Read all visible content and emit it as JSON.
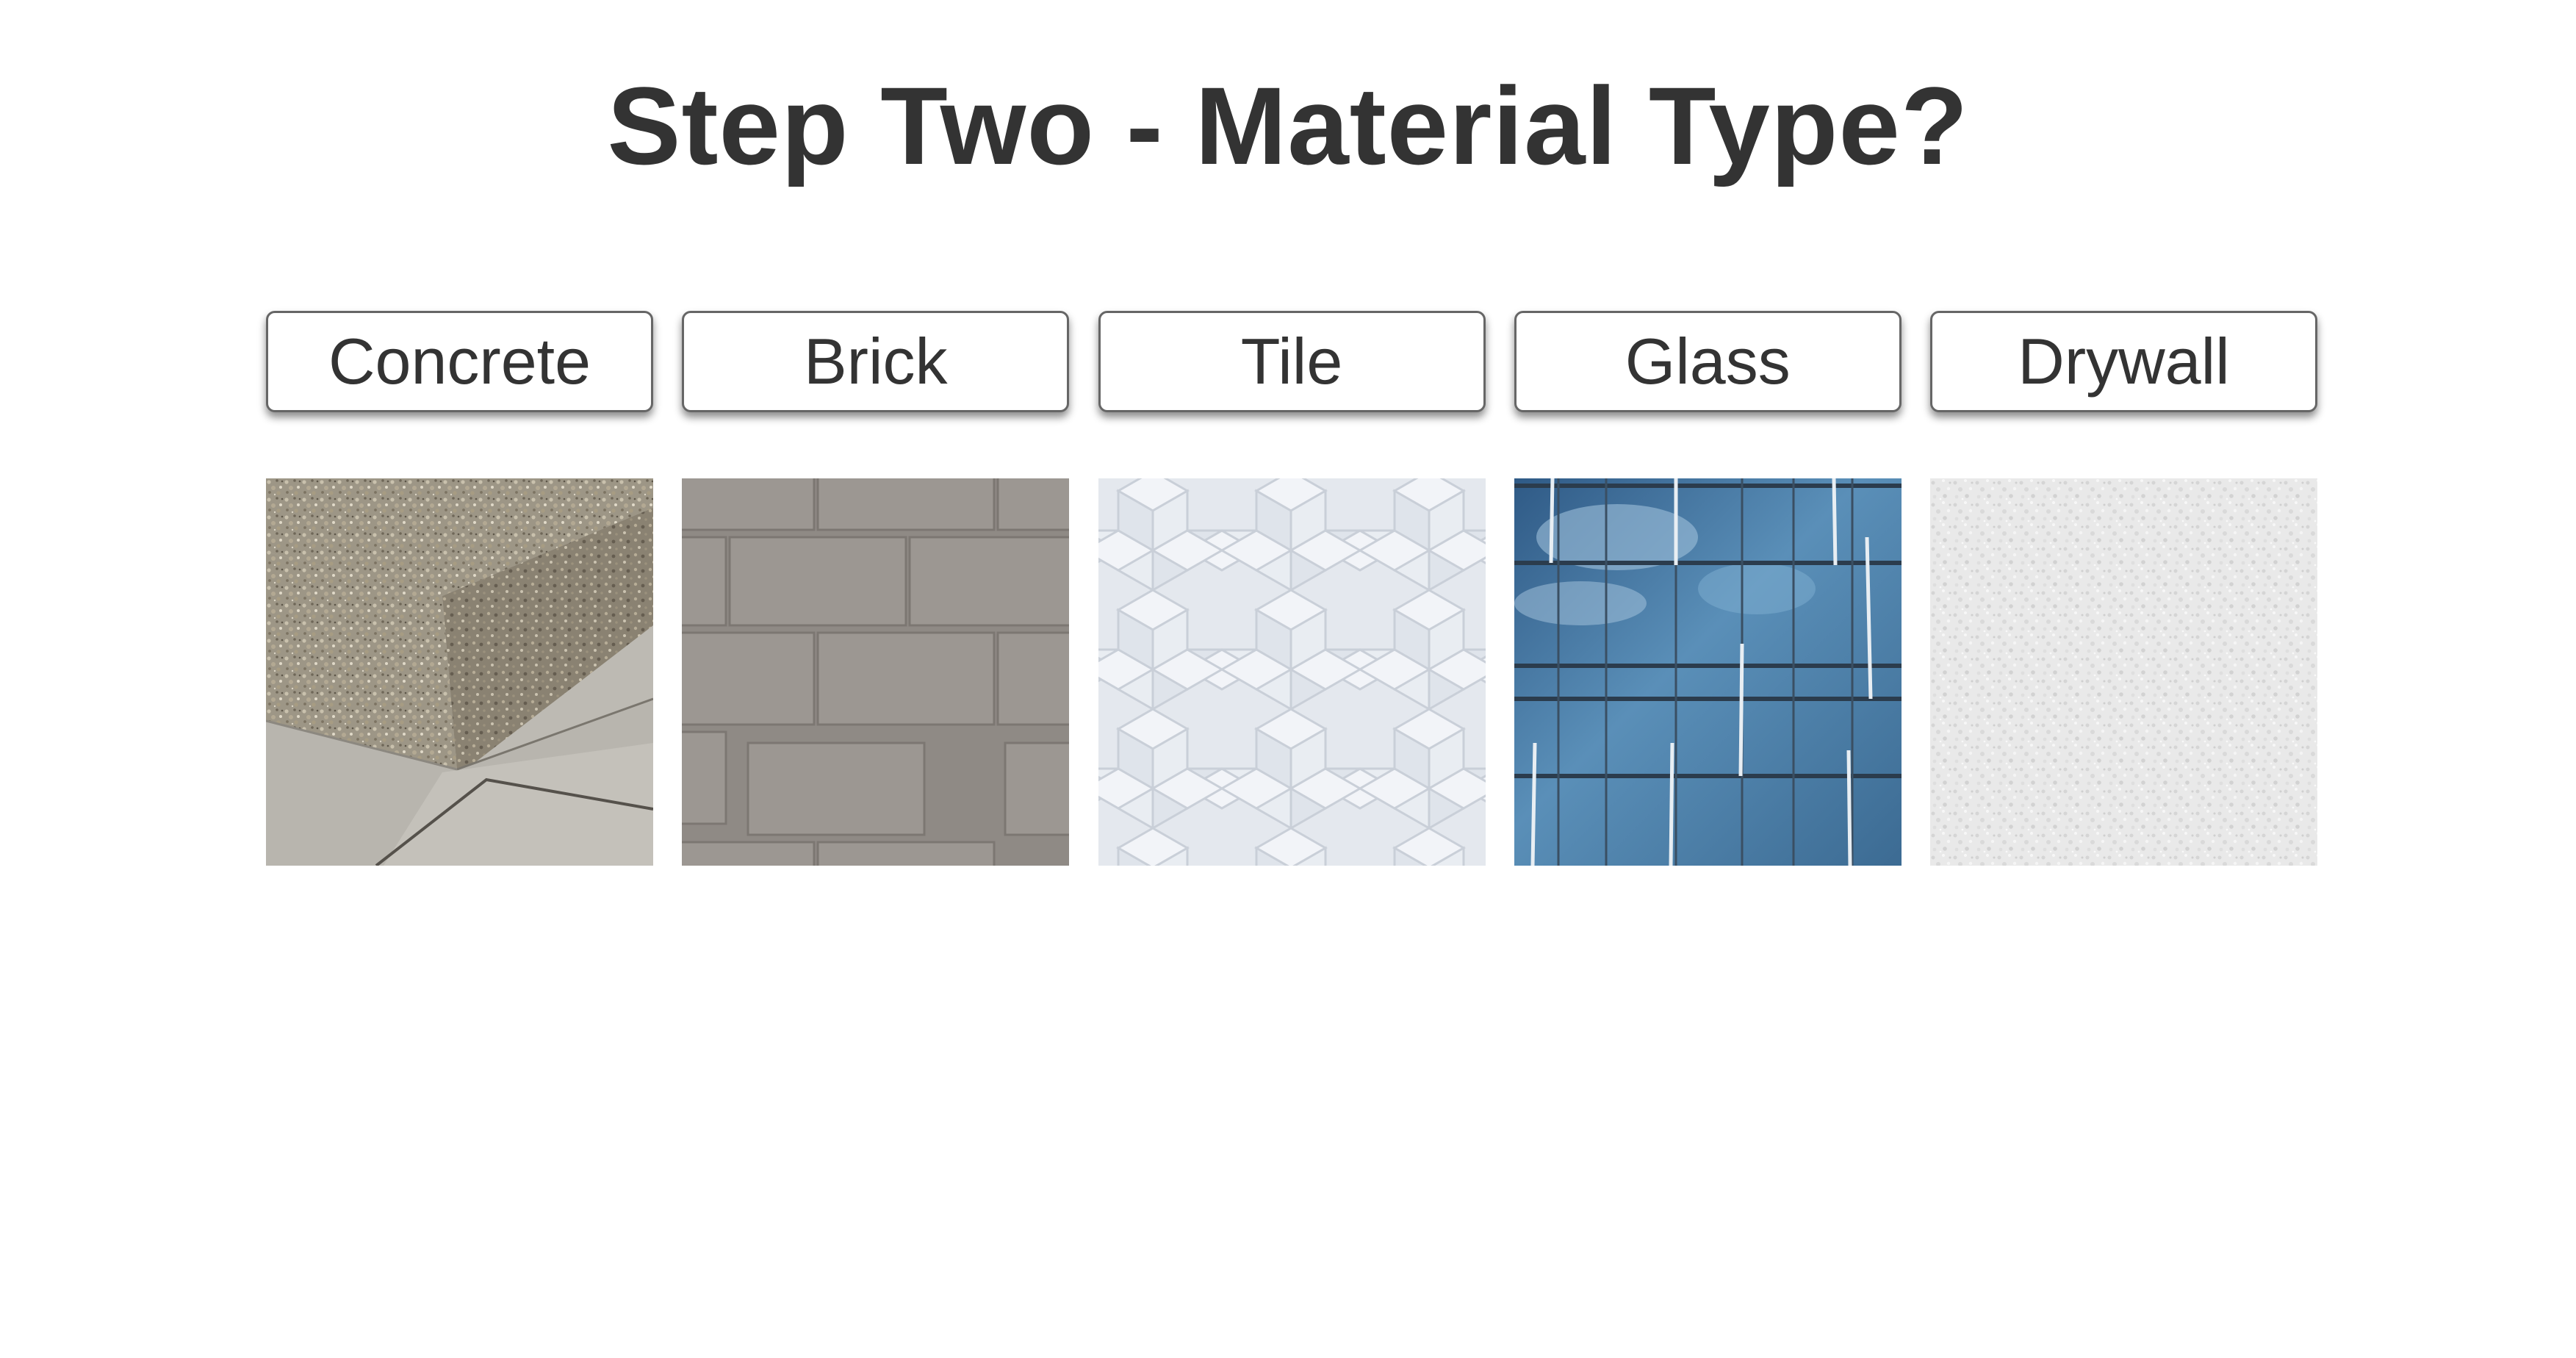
{
  "page": {
    "title": "Step Two - Material Type?"
  },
  "materials": [
    {
      "label": "Concrete",
      "image": "concrete-aggregate-curb-photo"
    },
    {
      "label": "Brick",
      "image": "gray-brick-wall-photo"
    },
    {
      "label": "Tile",
      "image": "white-diamond-tile-photo"
    },
    {
      "label": "Glass",
      "image": "glass-curtain-wall-photo"
    },
    {
      "label": "Drywall",
      "image": "white-textured-drywall-photo"
    }
  ],
  "colors": {
    "text": "#333333",
    "button_border": "#666666",
    "background": "#ffffff"
  }
}
